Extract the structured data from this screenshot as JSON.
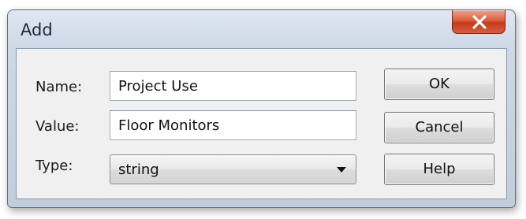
{
  "window": {
    "title": "Add"
  },
  "form": {
    "name": {
      "label": "Name:",
      "value": "Project Use"
    },
    "value": {
      "label": "Value:",
      "value": "Floor Monitors"
    },
    "type": {
      "label": "Type:",
      "selected": "string"
    }
  },
  "buttons": {
    "ok": "OK",
    "cancel": "Cancel",
    "help": "Help"
  },
  "icons": {
    "close": "close-icon",
    "dropdown": "chevron-down-icon"
  },
  "colors": {
    "close_button": "#d4503a",
    "frame": "#c8d4e2"
  }
}
